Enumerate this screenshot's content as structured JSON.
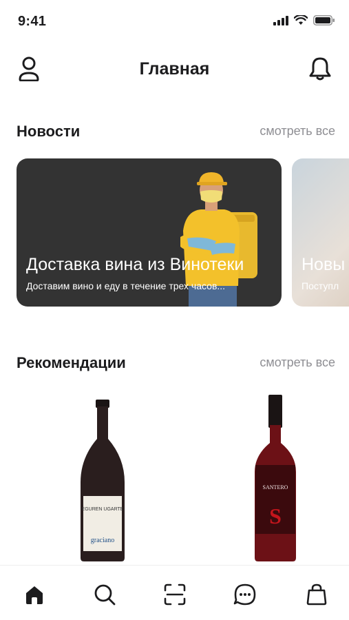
{
  "status_bar": {
    "time": "9:41"
  },
  "header": {
    "title": "Главная"
  },
  "news": {
    "title": "Новости",
    "see_all": "смотреть все",
    "cards": [
      {
        "title": "Доставка вина из Винотеки",
        "subtitle": "Доставим вино и еду в течение трех часов..."
      },
      {
        "title": "Новы",
        "subtitle": "Поступл"
      }
    ]
  },
  "recommendations": {
    "title": "Рекомендации",
    "see_all": "смотреть все",
    "items": [
      {
        "label_lines": [
          "EGUREN UGARTE",
          "graciano"
        ]
      },
      {
        "label_lines": [
          "SANTERO",
          "S"
        ]
      }
    ]
  },
  "tab_bar": {
    "tabs": [
      "home-icon",
      "search-icon",
      "scan-icon",
      "chat-icon",
      "cart-icon"
    ]
  },
  "colors": {
    "accent": "#1c1c1e",
    "muted": "#8e8e93",
    "card_bg": "#333333",
    "wine_red": "#c4151c"
  }
}
